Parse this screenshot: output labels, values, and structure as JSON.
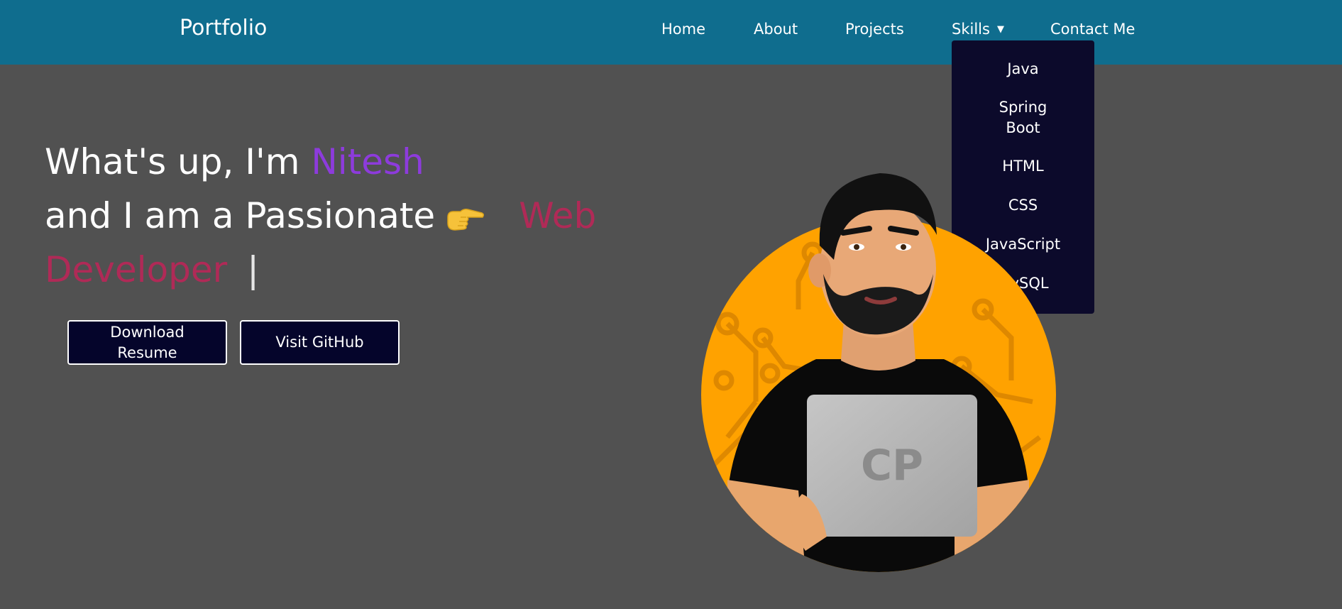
{
  "nav": {
    "brand": "Portfolio",
    "items": [
      {
        "label": "Home"
      },
      {
        "label": "About"
      },
      {
        "label": "Projects"
      },
      {
        "label": "Skills",
        "caret": "▼"
      },
      {
        "label": "Contact Me"
      }
    ]
  },
  "skills_dropdown": {
    "items": [
      "Java",
      "Spring",
      "Boot",
      "HTML",
      "CSS",
      "JavaScript",
      "MySQL"
    ]
  },
  "hero": {
    "line1_prefix": "What's up, I'm ",
    "name": "Nitesh",
    "line2_prefix": "and I am a Passionate",
    "role_word1": "Web",
    "role_word2": "Developer",
    "cursor": "|",
    "pointer_icon": "backhand-index-pointing-right-icon"
  },
  "buttons": {
    "resume_line1": "Download",
    "resume_line2": "Resume",
    "github": "Visit GitHub"
  },
  "avatar": {
    "laptop_logo": "CP"
  },
  "colors": {
    "navbar": "#0f6d8e",
    "background": "#515151",
    "dropdown": "#0c0a2b",
    "name_accent": "#8d3bdc",
    "role_accent": "#b02a57",
    "button_bg": "#05052b",
    "avatar_circle": "#ffa200"
  }
}
